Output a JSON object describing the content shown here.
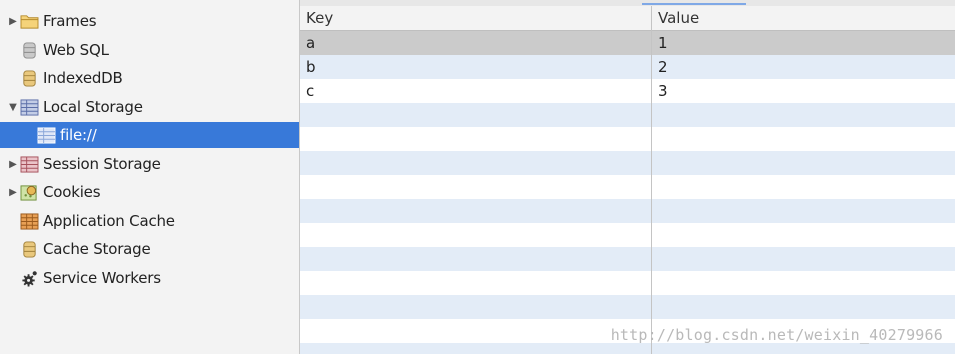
{
  "sidebar": {
    "items": [
      {
        "label": "Frames",
        "icon": "folder-icon",
        "arrow": "▶"
      },
      {
        "label": "Web SQL",
        "icon": "database-icon",
        "arrow": ""
      },
      {
        "label": "IndexedDB",
        "icon": "database-icon",
        "arrow": ""
      },
      {
        "label": "Local Storage",
        "icon": "table-icon",
        "arrow": "▼"
      },
      {
        "label": "file://",
        "icon": "table-icon",
        "arrow": "",
        "selected": true
      },
      {
        "label": "Session Storage",
        "icon": "table-icon",
        "arrow": "▶"
      },
      {
        "label": "Cookies",
        "icon": "cookie-icon",
        "arrow": "▶"
      },
      {
        "label": "Application Cache",
        "icon": "grid-icon",
        "arrow": ""
      },
      {
        "label": "Cache Storage",
        "icon": "database-icon",
        "arrow": ""
      },
      {
        "label": "Service Workers",
        "icon": "gear-icon",
        "arrow": ""
      }
    ]
  },
  "grid": {
    "columns": {
      "key": "Key",
      "value": "Value"
    },
    "rows": [
      {
        "key": "a",
        "value": "1",
        "selected": true
      },
      {
        "key": "b",
        "value": "2"
      },
      {
        "key": "c",
        "value": "3"
      }
    ]
  },
  "watermark": "http://blog.csdn.net/weixin_40279966",
  "colors": {
    "selection": "#3879d9",
    "row_stripe": "#e3ecf7",
    "row_selected": "#cbcbcb"
  }
}
